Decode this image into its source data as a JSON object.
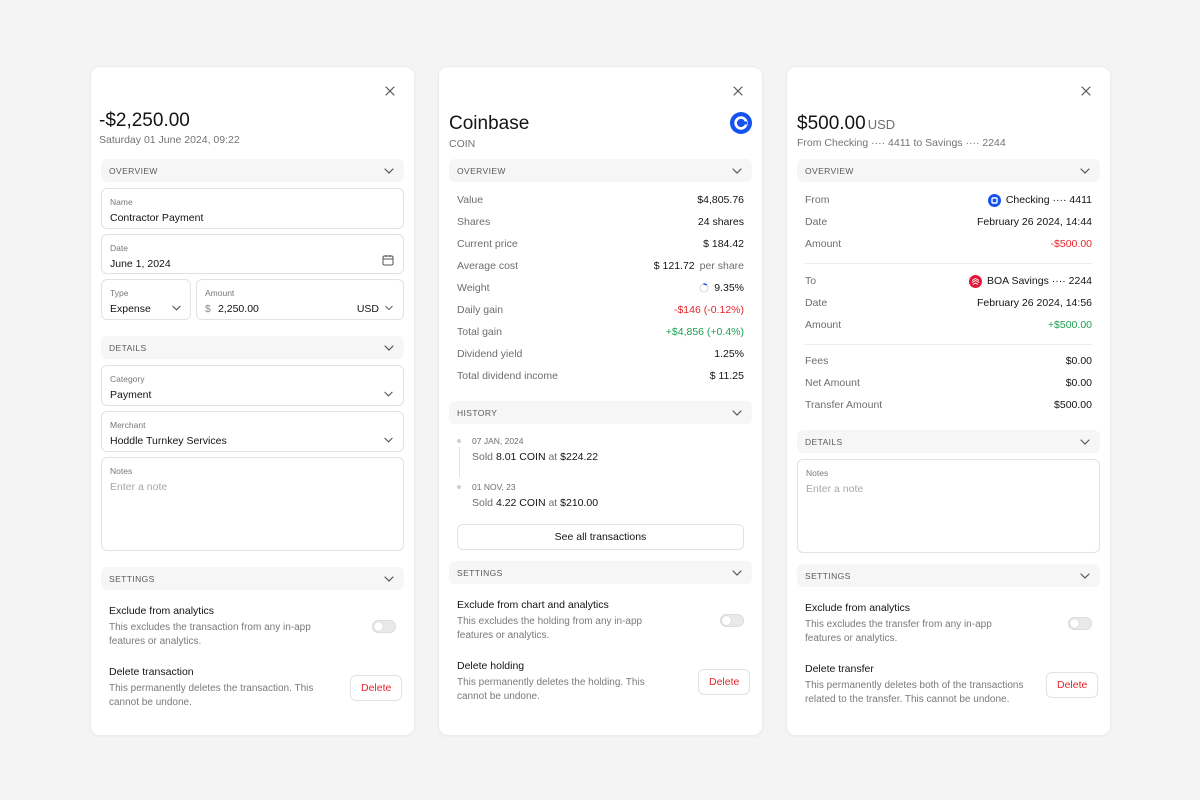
{
  "colors": {
    "negative": "#e5252a",
    "positive": "#1e9e50",
    "coinbase_blue": "#1652f0",
    "boa_red": "#e31837"
  },
  "card1": {
    "amount": "-$2,250.00",
    "datetime": "Saturday 01 June 2024, 09:22",
    "overview_label": "OVERVIEW",
    "name_label": "Name",
    "name_value": "Contractor Payment",
    "date_label": "Date",
    "date_value": "June 1, 2024",
    "type_label": "Type",
    "type_value": "Expense",
    "amount_label": "Amount",
    "amount_symbol": "$",
    "amount_value": "2,250.00",
    "currency": "USD",
    "details_label": "DETAILS",
    "category_label": "Category",
    "category_value": "Payment",
    "merchant_label": "Merchant",
    "merchant_value": "Hoddle Turnkey Services",
    "notes_label": "Notes",
    "notes_placeholder": "Enter a note",
    "settings_label": "SETTINGS",
    "exclude_title": "Exclude from analytics",
    "exclude_desc": "This excludes the transaction from any in-app features or analytics.",
    "delete_title": "Delete transaction",
    "delete_desc": "This permanently deletes the transaction. This cannot be undone.",
    "delete_button": "Delete"
  },
  "card2": {
    "title": "Coinbase",
    "ticker": "COIN",
    "overview_label": "OVERVIEW",
    "rows": [
      {
        "k": "Value",
        "v": "$4,805.76"
      },
      {
        "k": "Shares",
        "v": "24 shares"
      },
      {
        "k": "Current price",
        "v": "$ 184.42"
      },
      {
        "k": "Average cost",
        "v": "$ 121.72",
        "suffix": "per share"
      },
      {
        "k": "Weight",
        "v": "9.35%"
      },
      {
        "k": "Daily gain",
        "v": "-$146 (-0.12%)"
      },
      {
        "k": "Total gain",
        "v": "+$4,856 (+0.4%)"
      },
      {
        "k": "Dividend yield",
        "v": "1.25%"
      },
      {
        "k": "Total dividend income",
        "v": "$ 11.25"
      }
    ],
    "weight_fraction": 0.0935,
    "history_label": "HISTORY",
    "history": [
      {
        "date": "07 JAN, 2024",
        "prefix": "Sold ",
        "qty": "8.01 COIN",
        "mid": " at ",
        "price": "$224.22"
      },
      {
        "date": "01 NOV, 23",
        "prefix": "Sold ",
        "qty": "4.22 COIN",
        "mid": " at ",
        "price": "$210.00"
      }
    ],
    "see_all": "See all transactions",
    "settings_label": "SETTINGS",
    "exclude_title": "Exclude from chart and analytics",
    "exclude_desc": "This excludes the holding from any in-app features or analytics.",
    "delete_title": "Delete holding",
    "delete_desc": "This permanently deletes the holding. This cannot be undone.",
    "delete_button": "Delete"
  },
  "card3": {
    "amount": "$500.00",
    "currency": "USD",
    "subtitle": "From Checking ···· 4411 to Savings ···· 2244",
    "overview_label": "OVERVIEW",
    "from_label": "From",
    "from_value": "Checking ···· 4411",
    "date1_label": "Date",
    "date1_value": "February 26 2024, 14:44",
    "amount1_label": "Amount",
    "amount1_value": "-$500.00",
    "to_label": "To",
    "to_value": "BOA Savings ···· 2244",
    "date2_label": "Date",
    "date2_value": "February 26 2024, 14:56",
    "amount2_label": "Amount",
    "amount2_value": "+$500.00",
    "fees_label": "Fees",
    "fees_value": "$0.00",
    "net_label": "Net Amount",
    "net_value": "$0.00",
    "transfer_label": "Transfer Amount",
    "transfer_value": "$500.00",
    "details_label": "DETAILS",
    "notes_label": "Notes",
    "notes_placeholder": "Enter a note",
    "settings_label": "SETTINGS",
    "exclude_title": "Exclude from analytics",
    "exclude_desc": "This excludes the transfer from any in-app features or analytics.",
    "delete_title": "Delete transfer",
    "delete_desc": "This permanently deletes both of the transactions related to the transfer. This cannot be undone.",
    "delete_button": "Delete"
  }
}
